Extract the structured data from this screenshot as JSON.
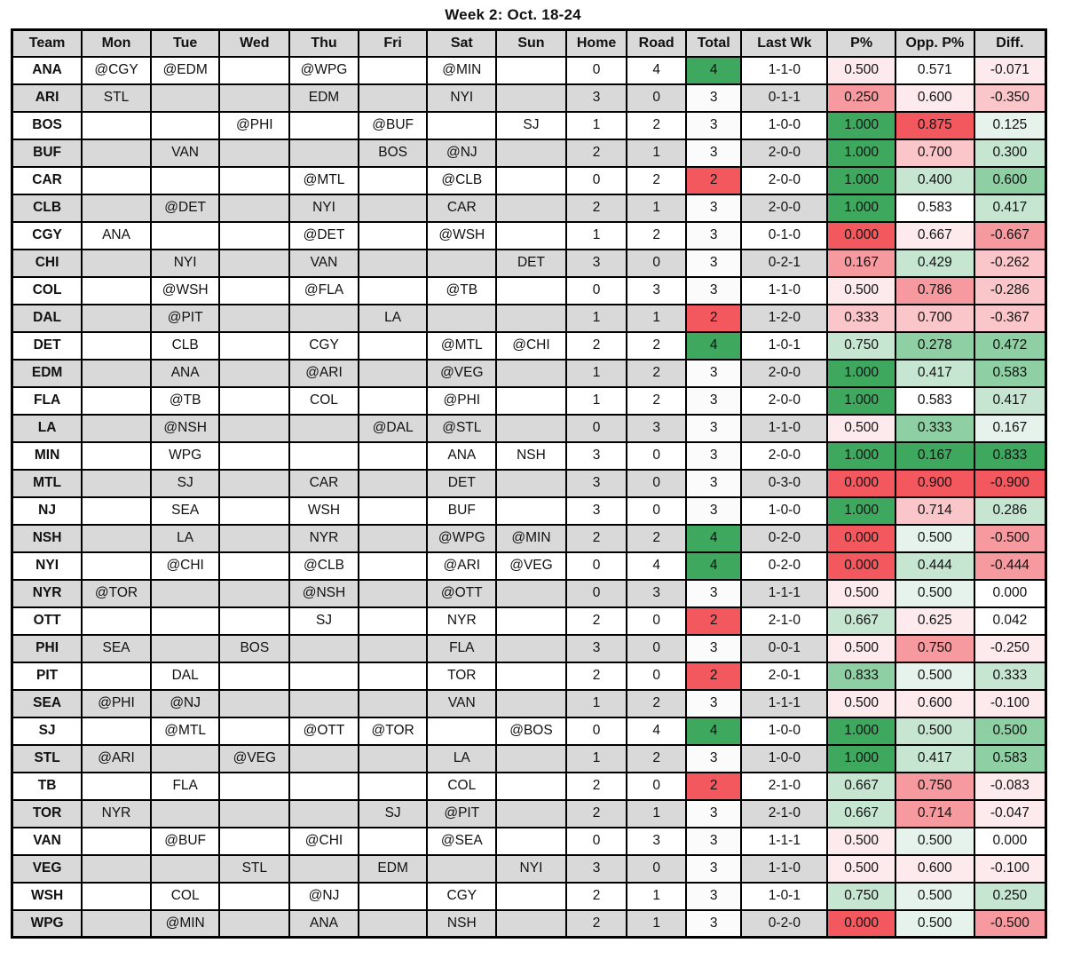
{
  "title": "Week 2: Oct. 18-24",
  "columns": [
    "Team",
    "Mon",
    "Tue",
    "Wed",
    "Thu",
    "Fri",
    "Sat",
    "Sun",
    "Home",
    "Road",
    "Total",
    "Last Wk",
    "P%",
    "Opp. P%",
    "Diff."
  ],
  "palette": {
    "header_bg": "#d9d9d9",
    "row_odd_bg": "#ffffff",
    "row_even_bg": "#d9d9d9",
    "green_strong": "#3fa85f",
    "green_mid": "#8ecfa4",
    "green_light": "#c6e6d2",
    "green_faint": "#e6f3ec",
    "red_strong": "#f4585f",
    "red_mid": "#f79aa0",
    "red_light": "#fac6ca",
    "red_faint": "#fdeaec",
    "neutral": "#fbfbfc"
  },
  "chart_data": {
    "type": "table",
    "title": "Week 2: Oct. 18-24",
    "columns": [
      "Team",
      "Mon",
      "Tue",
      "Wed",
      "Thu",
      "Fri",
      "Sat",
      "Sun",
      "Home",
      "Road",
      "Total",
      "Last Wk",
      "P%",
      "Opp. P%",
      "Diff."
    ],
    "rows": [
      {
        "team": "ANA",
        "mon": "@CGY",
        "tue": "@EDM",
        "wed": "",
        "thu": "@WPG",
        "fri": "",
        "sat": "@MIN",
        "sun": "",
        "home": "0",
        "road": "4",
        "total": "4",
        "last_wk": "1-1-0",
        "p": "0.500",
        "opp_p": "0.571",
        "diff": "-0.071",
        "c_total": "#3fa85f",
        "c_p": "#fdeaec",
        "c_opp": "#ffffff",
        "c_diff": "#fdeaec"
      },
      {
        "team": "ARI",
        "mon": "STL",
        "tue": "",
        "wed": "",
        "thu": "EDM",
        "fri": "",
        "sat": "NYI",
        "sun": "",
        "home": "3",
        "road": "0",
        "total": "3",
        "last_wk": "0-1-1",
        "p": "0.250",
        "opp_p": "0.600",
        "diff": "-0.350",
        "c_total": "#fbfbfc",
        "c_p": "#f79aa0",
        "c_opp": "#fdeaec",
        "c_diff": "#fac6ca"
      },
      {
        "team": "BOS",
        "mon": "",
        "tue": "",
        "wed": "@PHI",
        "thu": "",
        "fri": "@BUF",
        "sat": "",
        "sun": "SJ",
        "home": "1",
        "road": "2",
        "total": "3",
        "last_wk": "1-0-0",
        "p": "1.000",
        "opp_p": "0.875",
        "diff": "0.125",
        "c_total": "#fbfbfc",
        "c_p": "#3fa85f",
        "c_opp": "#f4585f",
        "c_diff": "#e6f3ec"
      },
      {
        "team": "BUF",
        "mon": "",
        "tue": "VAN",
        "wed": "",
        "thu": "",
        "fri": "BOS",
        "sat": "@NJ",
        "sun": "",
        "home": "2",
        "road": "1",
        "total": "3",
        "last_wk": "2-0-0",
        "p": "1.000",
        "opp_p": "0.700",
        "diff": "0.300",
        "c_total": "#fbfbfc",
        "c_p": "#3fa85f",
        "c_opp": "#fac6ca",
        "c_diff": "#c6e6d2"
      },
      {
        "team": "CAR",
        "mon": "",
        "tue": "",
        "wed": "",
        "thu": "@MTL",
        "fri": "",
        "sat": "@CLB",
        "sun": "",
        "home": "0",
        "road": "2",
        "total": "2",
        "last_wk": "2-0-0",
        "p": "1.000",
        "opp_p": "0.400",
        "diff": "0.600",
        "c_total": "#f4585f",
        "c_p": "#3fa85f",
        "c_opp": "#c6e6d2",
        "c_diff": "#8ecfa4"
      },
      {
        "team": "CLB",
        "mon": "",
        "tue": "@DET",
        "wed": "",
        "thu": "NYI",
        "fri": "",
        "sat": "CAR",
        "sun": "",
        "home": "2",
        "road": "1",
        "total": "3",
        "last_wk": "2-0-0",
        "p": "1.000",
        "opp_p": "0.583",
        "diff": "0.417",
        "c_total": "#fbfbfc",
        "c_p": "#3fa85f",
        "c_opp": "#ffffff",
        "c_diff": "#c6e6d2"
      },
      {
        "team": "CGY",
        "mon": "ANA",
        "tue": "",
        "wed": "",
        "thu": "@DET",
        "fri": "",
        "sat": "@WSH",
        "sun": "",
        "home": "1",
        "road": "2",
        "total": "3",
        "last_wk": "0-1-0",
        "p": "0.000",
        "opp_p": "0.667",
        "diff": "-0.667",
        "c_total": "#fbfbfc",
        "c_p": "#f4585f",
        "c_opp": "#fdeaec",
        "c_diff": "#f79aa0"
      },
      {
        "team": "CHI",
        "mon": "",
        "tue": "NYI",
        "wed": "",
        "thu": "VAN",
        "fri": "",
        "sat": "",
        "sun": "DET",
        "home": "3",
        "road": "0",
        "total": "3",
        "last_wk": "0-2-1",
        "p": "0.167",
        "opp_p": "0.429",
        "diff": "-0.262",
        "c_total": "#fbfbfc",
        "c_p": "#f79aa0",
        "c_opp": "#c6e6d2",
        "c_diff": "#fac6ca"
      },
      {
        "team": "COL",
        "mon": "",
        "tue": "@WSH",
        "wed": "",
        "thu": "@FLA",
        "fri": "",
        "sat": "@TB",
        "sun": "",
        "home": "0",
        "road": "3",
        "total": "3",
        "last_wk": "1-1-0",
        "p": "0.500",
        "opp_p": "0.786",
        "diff": "-0.286",
        "c_total": "#fbfbfc",
        "c_p": "#fdeaec",
        "c_opp": "#f79aa0",
        "c_diff": "#fac6ca"
      },
      {
        "team": "DAL",
        "mon": "",
        "tue": "@PIT",
        "wed": "",
        "thu": "",
        "fri": "LA",
        "sat": "",
        "sun": "",
        "home": "1",
        "road": "1",
        "total": "2",
        "last_wk": "1-2-0",
        "p": "0.333",
        "opp_p": "0.700",
        "diff": "-0.367",
        "c_total": "#f4585f",
        "c_p": "#fac6ca",
        "c_opp": "#fac6ca",
        "c_diff": "#fac6ca"
      },
      {
        "team": "DET",
        "mon": "",
        "tue": "CLB",
        "wed": "",
        "thu": "CGY",
        "fri": "",
        "sat": "@MTL",
        "sun": "@CHI",
        "home": "2",
        "road": "2",
        "total": "4",
        "last_wk": "1-0-1",
        "p": "0.750",
        "opp_p": "0.278",
        "diff": "0.472",
        "c_total": "#3fa85f",
        "c_p": "#c6e6d2",
        "c_opp": "#8ecfa4",
        "c_diff": "#8ecfa4"
      },
      {
        "team": "EDM",
        "mon": "",
        "tue": "ANA",
        "wed": "",
        "thu": "@ARI",
        "fri": "",
        "sat": "@VEG",
        "sun": "",
        "home": "1",
        "road": "2",
        "total": "3",
        "last_wk": "2-0-0",
        "p": "1.000",
        "opp_p": "0.417",
        "diff": "0.583",
        "c_total": "#fbfbfc",
        "c_p": "#3fa85f",
        "c_opp": "#c6e6d2",
        "c_diff": "#8ecfa4"
      },
      {
        "team": "FLA",
        "mon": "",
        "tue": "@TB",
        "wed": "",
        "thu": "COL",
        "fri": "",
        "sat": "@PHI",
        "sun": "",
        "home": "1",
        "road": "2",
        "total": "3",
        "last_wk": "2-0-0",
        "p": "1.000",
        "opp_p": "0.583",
        "diff": "0.417",
        "c_total": "#fbfbfc",
        "c_p": "#3fa85f",
        "c_opp": "#ffffff",
        "c_diff": "#c6e6d2"
      },
      {
        "team": "LA",
        "mon": "",
        "tue": "@NSH",
        "wed": "",
        "thu": "",
        "fri": "@DAL",
        "sat": "@STL",
        "sun": "",
        "home": "0",
        "road": "3",
        "total": "3",
        "last_wk": "1-1-0",
        "p": "0.500",
        "opp_p": "0.333",
        "diff": "0.167",
        "c_total": "#fbfbfc",
        "c_p": "#fdeaec",
        "c_opp": "#8ecfa4",
        "c_diff": "#e6f3ec"
      },
      {
        "team": "MIN",
        "mon": "",
        "tue": "WPG",
        "wed": "",
        "thu": "",
        "fri": "",
        "sat": "ANA",
        "sun": "NSH",
        "home": "3",
        "road": "0",
        "total": "3",
        "last_wk": "2-0-0",
        "p": "1.000",
        "opp_p": "0.167",
        "diff": "0.833",
        "c_total": "#fbfbfc",
        "c_p": "#3fa85f",
        "c_opp": "#3fa85f",
        "c_diff": "#3fa85f"
      },
      {
        "team": "MTL",
        "mon": "",
        "tue": "SJ",
        "wed": "",
        "thu": "CAR",
        "fri": "",
        "sat": "DET",
        "sun": "",
        "home": "3",
        "road": "0",
        "total": "3",
        "last_wk": "0-3-0",
        "p": "0.000",
        "opp_p": "0.900",
        "diff": "-0.900",
        "c_total": "#fbfbfc",
        "c_p": "#f4585f",
        "c_opp": "#f4585f",
        "c_diff": "#f4585f"
      },
      {
        "team": "NJ",
        "mon": "",
        "tue": "SEA",
        "wed": "",
        "thu": "WSH",
        "fri": "",
        "sat": "BUF",
        "sun": "",
        "home": "3",
        "road": "0",
        "total": "3",
        "last_wk": "1-0-0",
        "p": "1.000",
        "opp_p": "0.714",
        "diff": "0.286",
        "c_total": "#fbfbfc",
        "c_p": "#3fa85f",
        "c_opp": "#fac6ca",
        "c_diff": "#c6e6d2"
      },
      {
        "team": "NSH",
        "mon": "",
        "tue": "LA",
        "wed": "",
        "thu": "NYR",
        "fri": "",
        "sat": "@WPG",
        "sun": "@MIN",
        "home": "2",
        "road": "2",
        "total": "4",
        "last_wk": "0-2-0",
        "p": "0.000",
        "opp_p": "0.500",
        "diff": "-0.500",
        "c_total": "#3fa85f",
        "c_p": "#f4585f",
        "c_opp": "#e6f3ec",
        "c_diff": "#f79aa0"
      },
      {
        "team": "NYI",
        "mon": "",
        "tue": "@CHI",
        "wed": "",
        "thu": "@CLB",
        "fri": "",
        "sat": "@ARI",
        "sun": "@VEG",
        "home": "0",
        "road": "4",
        "total": "4",
        "last_wk": "0-2-0",
        "p": "0.000",
        "opp_p": "0.444",
        "diff": "-0.444",
        "c_total": "#3fa85f",
        "c_p": "#f4585f",
        "c_opp": "#c6e6d2",
        "c_diff": "#f79aa0"
      },
      {
        "team": "NYR",
        "mon": "@TOR",
        "tue": "",
        "wed": "",
        "thu": "@NSH",
        "fri": "",
        "sat": "@OTT",
        "sun": "",
        "home": "0",
        "road": "3",
        "total": "3",
        "last_wk": "1-1-1",
        "p": "0.500",
        "opp_p": "0.500",
        "diff": "0.000",
        "c_total": "#fbfbfc",
        "c_p": "#fdeaec",
        "c_opp": "#e6f3ec",
        "c_diff": "#ffffff"
      },
      {
        "team": "OTT",
        "mon": "",
        "tue": "",
        "wed": "",
        "thu": "SJ",
        "fri": "",
        "sat": "NYR",
        "sun": "",
        "home": "2",
        "road": "0",
        "total": "2",
        "last_wk": "2-1-0",
        "p": "0.667",
        "opp_p": "0.625",
        "diff": "0.042",
        "c_total": "#f4585f",
        "c_p": "#c6e6d2",
        "c_opp": "#fdeaec",
        "c_diff": "#ffffff"
      },
      {
        "team": "PHI",
        "mon": "SEA",
        "tue": "",
        "wed": "BOS",
        "thu": "",
        "fri": "",
        "sat": "FLA",
        "sun": "",
        "home": "3",
        "road": "0",
        "total": "3",
        "last_wk": "0-0-1",
        "p": "0.500",
        "opp_p": "0.750",
        "diff": "-0.250",
        "c_total": "#fbfbfc",
        "c_p": "#fdeaec",
        "c_opp": "#f79aa0",
        "c_diff": "#fdeaec"
      },
      {
        "team": "PIT",
        "mon": "",
        "tue": "DAL",
        "wed": "",
        "thu": "",
        "fri": "",
        "sat": "TOR",
        "sun": "",
        "home": "2",
        "road": "0",
        "total": "2",
        "last_wk": "2-0-1",
        "p": "0.833",
        "opp_p": "0.500",
        "diff": "0.333",
        "c_total": "#f4585f",
        "c_p": "#8ecfa4",
        "c_opp": "#e6f3ec",
        "c_diff": "#c6e6d2"
      },
      {
        "team": "SEA",
        "mon": "@PHI",
        "tue": "@NJ",
        "wed": "",
        "thu": "",
        "fri": "",
        "sat": "VAN",
        "sun": "",
        "home": "1",
        "road": "2",
        "total": "3",
        "last_wk": "1-1-1",
        "p": "0.500",
        "opp_p": "0.600",
        "diff": "-0.100",
        "c_total": "#fbfbfc",
        "c_p": "#fdeaec",
        "c_opp": "#fdeaec",
        "c_diff": "#fdeaec"
      },
      {
        "team": "SJ",
        "mon": "",
        "tue": "@MTL",
        "wed": "",
        "thu": "@OTT",
        "fri": "@TOR",
        "sat": "",
        "sun": "@BOS",
        "home": "0",
        "road": "4",
        "total": "4",
        "last_wk": "1-0-0",
        "p": "1.000",
        "opp_p": "0.500",
        "diff": "0.500",
        "c_total": "#3fa85f",
        "c_p": "#3fa85f",
        "c_opp": "#c6e6d2",
        "c_diff": "#8ecfa4"
      },
      {
        "team": "STL",
        "mon": "@ARI",
        "tue": "",
        "wed": "@VEG",
        "thu": "",
        "fri": "",
        "sat": "LA",
        "sun": "",
        "home": "1",
        "road": "2",
        "total": "3",
        "last_wk": "1-0-0",
        "p": "1.000",
        "opp_p": "0.417",
        "diff": "0.583",
        "c_total": "#fbfbfc",
        "c_p": "#3fa85f",
        "c_opp": "#c6e6d2",
        "c_diff": "#8ecfa4"
      },
      {
        "team": "TB",
        "mon": "",
        "tue": "FLA",
        "wed": "",
        "thu": "",
        "fri": "",
        "sat": "COL",
        "sun": "",
        "home": "2",
        "road": "0",
        "total": "2",
        "last_wk": "2-1-0",
        "p": "0.667",
        "opp_p": "0.750",
        "diff": "-0.083",
        "c_total": "#f4585f",
        "c_p": "#c6e6d2",
        "c_opp": "#f79aa0",
        "c_diff": "#fdeaec"
      },
      {
        "team": "TOR",
        "mon": "NYR",
        "tue": "",
        "wed": "",
        "thu": "",
        "fri": "SJ",
        "sat": "@PIT",
        "sun": "",
        "home": "2",
        "road": "1",
        "total": "3",
        "last_wk": "2-1-0",
        "p": "0.667",
        "opp_p": "0.714",
        "diff": "-0.047",
        "c_total": "#fbfbfc",
        "c_p": "#c6e6d2",
        "c_opp": "#f79aa0",
        "c_diff": "#fdeaec"
      },
      {
        "team": "VAN",
        "mon": "",
        "tue": "@BUF",
        "wed": "",
        "thu": "@CHI",
        "fri": "",
        "sat": "@SEA",
        "sun": "",
        "home": "0",
        "road": "3",
        "total": "3",
        "last_wk": "1-1-1",
        "p": "0.500",
        "opp_p": "0.500",
        "diff": "0.000",
        "c_total": "#fbfbfc",
        "c_p": "#fdeaec",
        "c_opp": "#e6f3ec",
        "c_diff": "#ffffff"
      },
      {
        "team": "VEG",
        "mon": "",
        "tue": "",
        "wed": "STL",
        "thu": "",
        "fri": "EDM",
        "sat": "",
        "sun": "NYI",
        "home": "3",
        "road": "0",
        "total": "3",
        "last_wk": "1-1-0",
        "p": "0.500",
        "opp_p": "0.600",
        "diff": "-0.100",
        "c_total": "#fbfbfc",
        "c_p": "#fdeaec",
        "c_opp": "#fdeaec",
        "c_diff": "#fdeaec"
      },
      {
        "team": "WSH",
        "mon": "",
        "tue": "COL",
        "wed": "",
        "thu": "@NJ",
        "fri": "",
        "sat": "CGY",
        "sun": "",
        "home": "2",
        "road": "1",
        "total": "3",
        "last_wk": "1-0-1",
        "p": "0.750",
        "opp_p": "0.500",
        "diff": "0.250",
        "c_total": "#fbfbfc",
        "c_p": "#c6e6d2",
        "c_opp": "#e6f3ec",
        "c_diff": "#c6e6d2"
      },
      {
        "team": "WPG",
        "mon": "",
        "tue": "@MIN",
        "wed": "",
        "thu": "ANA",
        "fri": "",
        "sat": "NSH",
        "sun": "",
        "home": "2",
        "road": "1",
        "total": "3",
        "last_wk": "0-2-0",
        "p": "0.000",
        "opp_p": "0.500",
        "diff": "-0.500",
        "c_total": "#fbfbfc",
        "c_p": "#f4585f",
        "c_opp": "#e6f3ec",
        "c_diff": "#f79aa0"
      }
    ]
  }
}
